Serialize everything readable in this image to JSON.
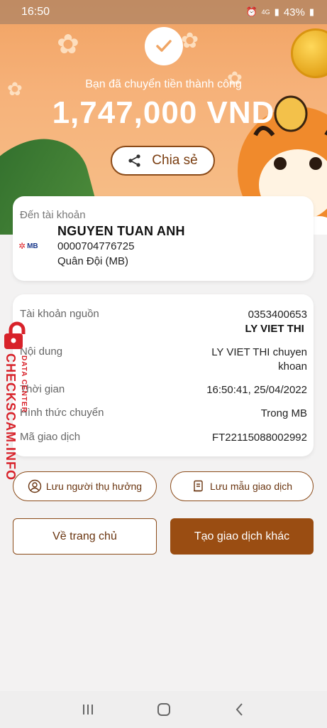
{
  "status_bar": {
    "time": "16:50",
    "network": "4G",
    "battery": "43%"
  },
  "success": {
    "message": "Bạn đã chuyển tiền thành công",
    "amount": "1,747,000 VND",
    "share_label": "Chia sẻ"
  },
  "destination": {
    "label": "Đến tài khoản",
    "bank_logo": "MB",
    "name": "NGUYEN TUAN ANH",
    "account": "0000704776725",
    "bank": "Quân Đội (MB)"
  },
  "details": {
    "source_label": "Tài khoản nguồn",
    "source_account": "0353400653",
    "source_name": "LY VIET THI",
    "content_label": "Nội dung",
    "content_line1": "LY VIET THI chuyen",
    "content_line2": "khoan",
    "time_label": "Thời gian",
    "time_value": "16:50:41, 25/04/2022",
    "method_label": "Hình thức chuyển",
    "method_value": "Trong MB",
    "txn_label": "Mã giao dịch",
    "txn_value": "FT22115088002992"
  },
  "actions": {
    "save_recipient": "Lưu người thụ hưởng",
    "save_template": "Lưu mẫu giao dịch",
    "home": "Về trang chủ",
    "new_transaction": "Tạo giao dịch khác"
  },
  "watermark": {
    "main": "CHECKSCAM.INFO",
    "sub": "DATA CENTER"
  },
  "colors": {
    "accent": "#9a4d12",
    "hero": "#f3a867",
    "watermark": "#d8222a"
  }
}
